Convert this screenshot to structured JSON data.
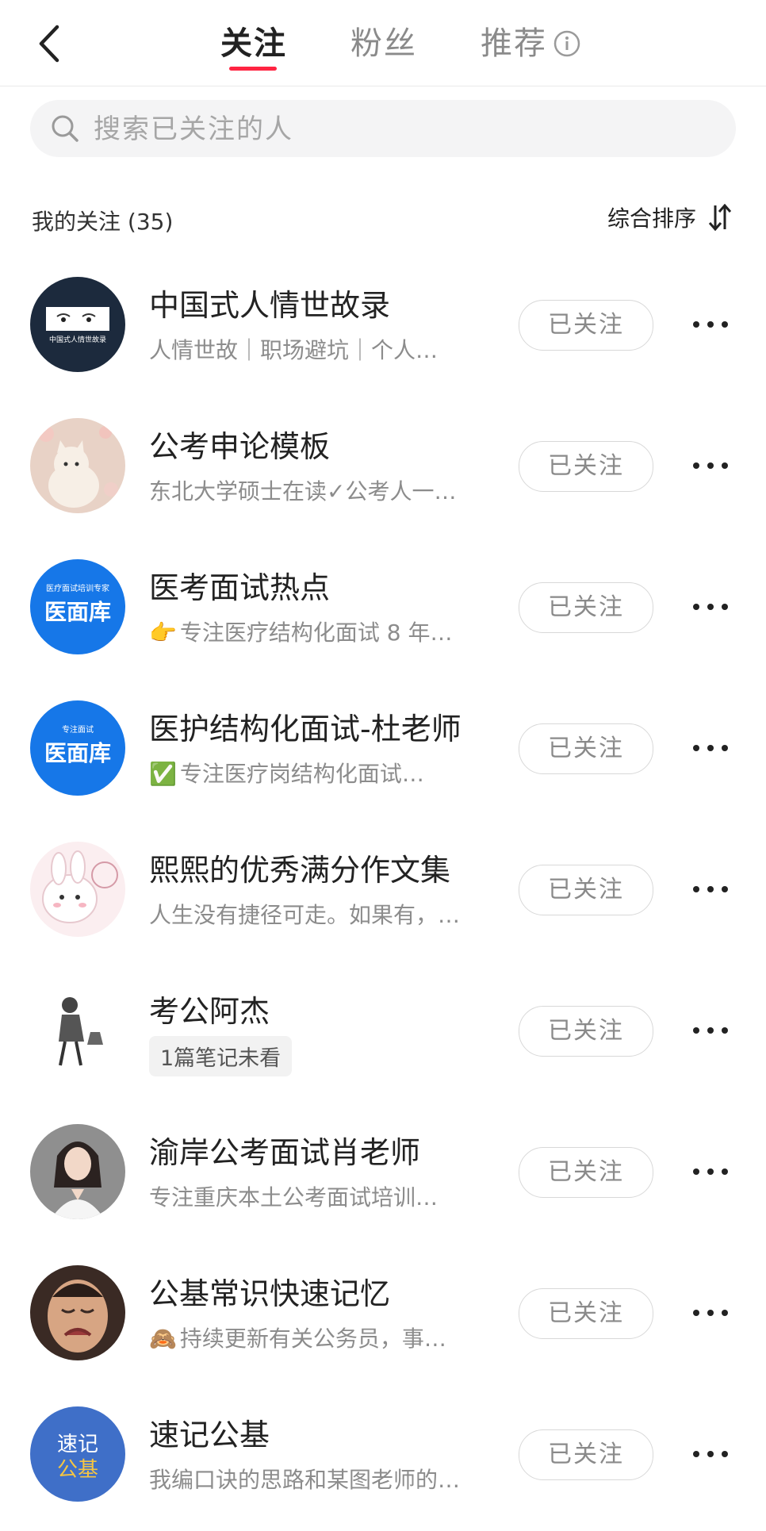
{
  "header": {
    "tabs": [
      {
        "label": "关注",
        "active": true
      },
      {
        "label": "粉丝",
        "active": false
      },
      {
        "label": "推荐",
        "active": false
      }
    ],
    "accent_color": "#ff2442"
  },
  "search": {
    "placeholder": "搜索已关注的人"
  },
  "section": {
    "title": "我的关注 (35)",
    "sort_label": "综合排序"
  },
  "follow_button_label": "已关注",
  "users": [
    {
      "name": "中国式人情世故录",
      "desc": "人情世故｜职场避坑｜个人…",
      "avatar": "dark-banner-portrait",
      "avatar_text": "中国式人情世故录"
    },
    {
      "name": "公考申论模板",
      "desc": "东北大学硕士在读✓公考人一…",
      "avatar": "cat-illustration"
    },
    {
      "name": "医考面试热点",
      "emoji": "👉",
      "desc": "专注医疗结构化面试 8 年…",
      "avatar": "yimianku-logo",
      "avatar_small": "医疗面试培训专家",
      "avatar_main": "医面库"
    },
    {
      "name": "医护结构化面试-杜老师",
      "emoji": "✅",
      "desc": "专注医疗岗结构化面试…",
      "avatar": "yimianku-logo",
      "avatar_small": "专注面试",
      "avatar_main": "医面库"
    },
    {
      "name": "熙熙的优秀满分作文集",
      "desc": "人生没有捷径可走。如果有，…",
      "avatar": "bunny-sticker"
    },
    {
      "name": "考公阿杰",
      "badge": "1篇笔记未看",
      "avatar": "sketch-man"
    },
    {
      "name": "渝岸公考面试肖老师",
      "desc": "专注重庆本土公考面试培训…",
      "avatar": "woman-portrait"
    },
    {
      "name": "公基常识快速记忆",
      "emoji": "🙈",
      "desc": "持续更新有关公务员，事…",
      "avatar": "crying-man"
    },
    {
      "name": "速记公基",
      "desc": "我编口诀的思路和某图老师的…",
      "avatar": "suji-logo",
      "avatar_text": "速记公基"
    }
  ]
}
